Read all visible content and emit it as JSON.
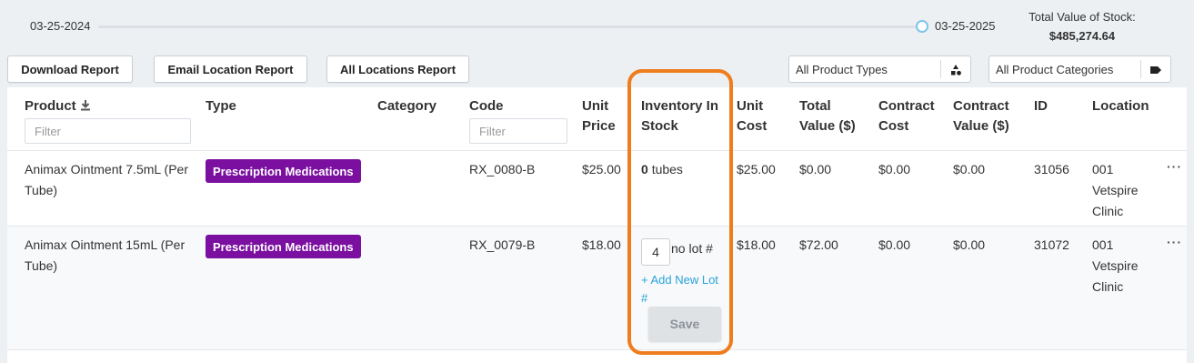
{
  "slider": {
    "start_date": "03-25-2024",
    "end_date": "03-25-2025"
  },
  "total": {
    "label": "Total Value of Stock:",
    "value": "$485,274.64"
  },
  "toolbar": {
    "download_label": "Download Report",
    "email_label": "Email Location Report",
    "all_locations_label": "All Locations Report"
  },
  "filters": {
    "product_types": "All Product Types",
    "product_categories": "All Product Categories"
  },
  "table": {
    "columns": {
      "product": "Product",
      "type": "Type",
      "category": "Category",
      "code": "Code",
      "unit_price": "Unit Price",
      "inventory": "Inventory In Stock",
      "unit_cost": "Unit Cost",
      "total_value": "Total Value ($)",
      "contract_cost": "Contract Cost",
      "contract_value": "Contract Value ($)",
      "id": "ID",
      "location": "Location"
    },
    "filter_placeholder": "Filter",
    "rows": [
      {
        "product": "Animax Ointment 7.5mL (Per Tube)",
        "type": "Prescription Medications",
        "category": "",
        "code": "RX_0080-B",
        "unit_price": "$25.00",
        "inventory_qty": "0",
        "inventory_unit": "tubes",
        "unit_cost": "$25.00",
        "total_value": "$0.00",
        "contract_cost": "$0.00",
        "contract_value": "$0.00",
        "id": "31056",
        "location": "001 Vetspire Clinic"
      },
      {
        "product": "Animax Ointment 15mL (Per Tube)",
        "type": "Prescription Medications",
        "category": "",
        "code": "RX_0079-B",
        "unit_price": "$18.00",
        "inventory_qty": "4",
        "lot_label": "no lot #",
        "add_lot": "+ Add New Lot #",
        "save": "Save",
        "unit_cost": "$18.00",
        "total_value": "$72.00",
        "contract_cost": "$0.00",
        "contract_value": "$0.00",
        "id": "31072",
        "location": "001 Vetspire Clinic"
      }
    ]
  },
  "colors": {
    "accent_highlight": "#f07d1d",
    "badge": "#7a0fa0",
    "link": "#27a2dd",
    "slider_handle": "#7fc4ea"
  },
  "more_glyph": "···"
}
